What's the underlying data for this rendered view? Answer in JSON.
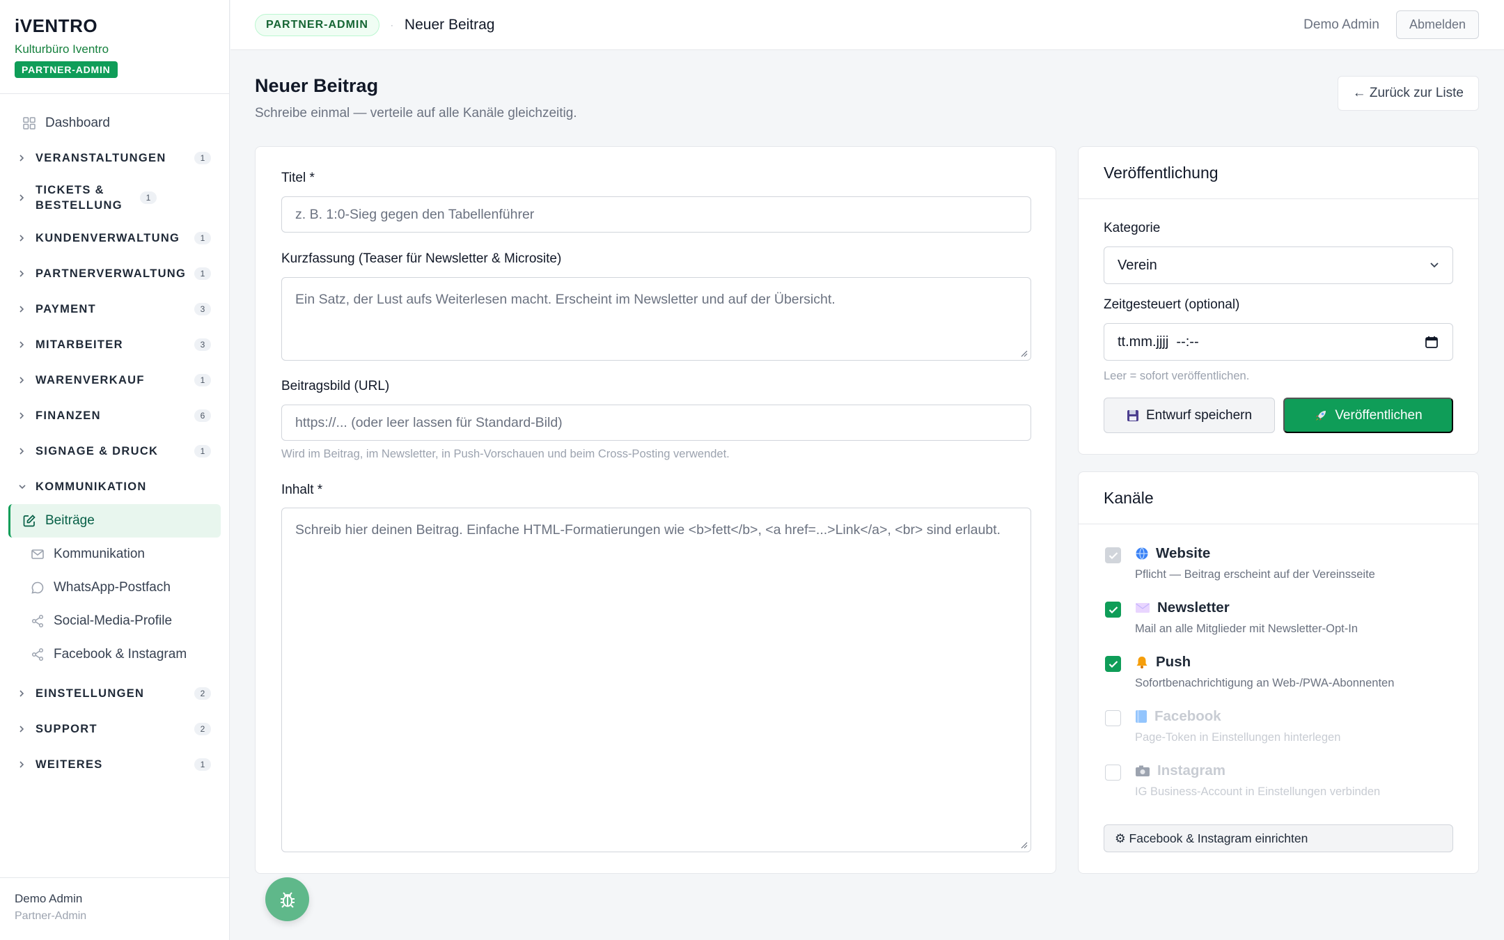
{
  "brand": {
    "logo": "iVENTRO",
    "org": "Kulturbüro Iventro",
    "badge": "PARTNER-ADMIN"
  },
  "nav": {
    "dashboard": "Dashboard",
    "groups": [
      {
        "label": "VERANSTALTUNGEN",
        "count": "1"
      },
      {
        "label": "TICKETS & BESTELLUNG",
        "count": "1"
      },
      {
        "label": "KUNDENVERWALTUNG",
        "count": "1"
      },
      {
        "label": "PARTNERVERWALTUNG",
        "count": "1"
      },
      {
        "label": "PAYMENT",
        "count": "3"
      },
      {
        "label": "MITARBEITER",
        "count": "3"
      },
      {
        "label": "WARENVERKAUF",
        "count": "1"
      },
      {
        "label": "FINANZEN",
        "count": "6"
      },
      {
        "label": "SIGNAGE & DRUCK",
        "count": "1"
      }
    ],
    "open_group": "KOMMUNIKATION",
    "sub_items": [
      "Beiträge",
      "Kommunikation",
      "WhatsApp-Postfach",
      "Social-Media-Profile",
      "Facebook & Instagram"
    ],
    "groups_after": [
      {
        "label": "EINSTELLUNGEN",
        "count": "2"
      },
      {
        "label": "SUPPORT",
        "count": "2"
      },
      {
        "label": "WEITERES",
        "count": "1"
      }
    ]
  },
  "sidebar_footer": {
    "name": "Demo Admin",
    "role": "Partner-Admin"
  },
  "topbar": {
    "badge": "PARTNER-ADMIN",
    "title": "Neuer Beitrag",
    "user": "Demo Admin",
    "logout": "Abmelden"
  },
  "page": {
    "title": "Neuer Beitrag",
    "subtitle": "Schreibe einmal — verteile auf alle Kanäle gleichzeitig.",
    "back": "← Zurück zur Liste"
  },
  "form": {
    "title_label": "Titel *",
    "title_placeholder": "z. B. 1:0-Sieg gegen den Tabellenführer",
    "teaser_label": "Kurzfassung (Teaser für Newsletter & Microsite)",
    "teaser_placeholder": "Ein Satz, der Lust aufs Weiterlesen macht. Erscheint im Newsletter und auf der Übersicht.",
    "image_label": "Beitragsbild (URL)",
    "image_placeholder": "https://... (oder leer lassen für Standard-Bild)",
    "image_hint": "Wird im Beitrag, im Newsletter, in Push-Vorschauen und beim Cross-Posting verwendet.",
    "content_label": "Inhalt *",
    "content_placeholder": "Schreib hier deinen Beitrag. Einfache HTML-Formatierungen wie <b>fett</b>, <a href=...>Link</a>, <br> sind erlaubt."
  },
  "publish": {
    "heading": "Veröffentlichung",
    "category_label": "Kategorie",
    "category_value": "Verein",
    "schedule_label": "Zeitgesteuert (optional)",
    "schedule_value": "tt.mm.jjjj  --:--",
    "schedule_hint": "Leer = sofort veröffentlichen.",
    "draft_button": "Entwurf speichern",
    "publish_button": "Veröffentlichen"
  },
  "channels": {
    "heading": "Kanäle",
    "items": [
      {
        "name": "Website",
        "desc": "Pflicht — Beitrag erscheint auf der Vereinsseite",
        "state": "required"
      },
      {
        "name": "Newsletter",
        "desc": "Mail an alle Mitglieder mit Newsletter-Opt-In",
        "state": "checked"
      },
      {
        "name": "Push",
        "desc": "Sofortbenachrichtigung an Web-/PWA-Abonnenten",
        "state": "checked"
      },
      {
        "name": "Facebook",
        "desc": "Page-Token in Einstellungen hinterlegen",
        "state": "disabled"
      },
      {
        "name": "Instagram",
        "desc": "IG Business-Account in Einstellungen verbinden",
        "state": "disabled"
      }
    ],
    "setup_button": "⚙ Facebook & Instagram einrichten"
  },
  "colors": {
    "accent": "#0f9d58",
    "sidebar_active_bg": "#e8f6ee",
    "fab": "#5fb88a"
  }
}
